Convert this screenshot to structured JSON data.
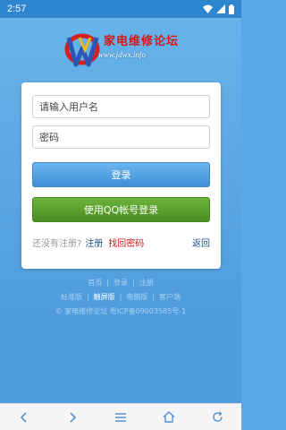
{
  "status_bar": {
    "time": "2:57"
  },
  "logo": {
    "title_cn": "家电维修论坛",
    "url_text": "www.jdwx.info"
  },
  "login_form": {
    "username_placeholder": "请输入用户名",
    "password_placeholder": "密码",
    "login_button": "登录",
    "qq_login_button": "使用QQ帐号登录",
    "no_account_text": "还没有注册?",
    "register_link": "注册",
    "forgot_password_link": "找回密码",
    "back_link": "返回"
  },
  "footer": {
    "links": [
      "首页",
      "登录",
      "注册"
    ],
    "versions": [
      "标准版",
      "触屏版",
      "电脑版",
      "客户端"
    ],
    "active_version": "触屏版",
    "copyright": "© 家电维修论坛 粤ICP备09003585号-1"
  },
  "browser_nav": {
    "icons": [
      "back-icon",
      "forward-icon",
      "menu-icon",
      "home-icon",
      "refresh-icon"
    ]
  }
}
